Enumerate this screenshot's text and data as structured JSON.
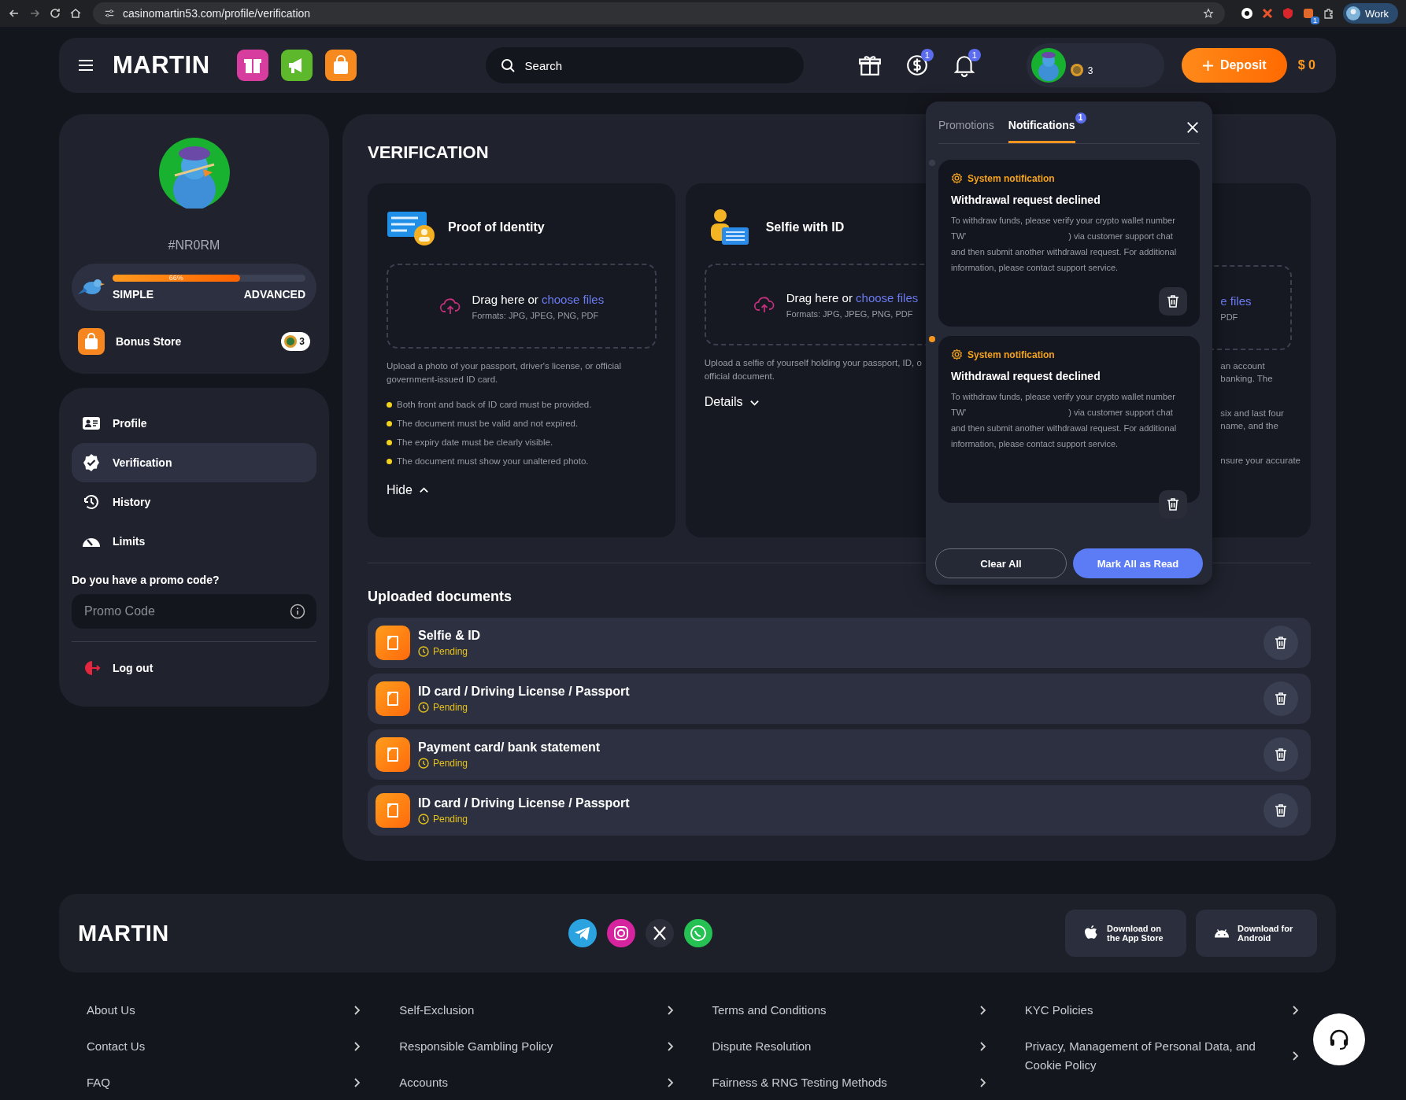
{
  "browser": {
    "url": "casinomartin53.com/profile/verification",
    "extension_badge": "1",
    "profile": "Work"
  },
  "header": {
    "logo": "MARTIN",
    "search": {
      "placeholder": "Search"
    },
    "coin_badge": "1",
    "bell_badge": "1",
    "coins": "3",
    "deposit": "Deposit",
    "balance": "$ 0"
  },
  "profile": {
    "username": "#NR0RM",
    "progress": {
      "level": 0.66,
      "label": "66%",
      "from": "SIMPLE",
      "to": "ADVANCED"
    },
    "bonus_store": {
      "label": "Bonus Store",
      "count": "3"
    }
  },
  "menu": [
    {
      "label": "Profile",
      "kind": "profile",
      "selected": false
    },
    {
      "label": "Verification",
      "kind": "verification",
      "selected": true
    },
    {
      "label": "History",
      "kind": "history",
      "selected": false
    },
    {
      "label": "Limits",
      "kind": "limits",
      "selected": false
    }
  ],
  "promo": {
    "question": "Do you have a promo code?",
    "placeholder": "Promo Code"
  },
  "logout": "Log out",
  "page_title": "VERIFICATION",
  "cards": [
    {
      "kind": "id",
      "title": "Proof of Identity",
      "drag": "Drag here or",
      "link": "choose files",
      "formats": "Formats: JPG, JPEG, PNG, PDF",
      "description": "Upload a photo of your passport, driver's license, or official government-issued ID card.",
      "requirements": [
        "Both front and back of ID card must be provided.",
        "The document must be valid and not expired.",
        "The expiry date must be clearly visible.",
        "The document must show your unaltered photo."
      ],
      "expanded": true,
      "toggle": "Hide"
    },
    {
      "kind": "selfie",
      "title": "Selfie with ID",
      "drag": "Drag here or",
      "link": "choose files",
      "formats": "Formats: JPG, JPEG, PNG, PDF",
      "description": "Upload a selfie of yourself holding your passport, ID, o official document.",
      "expanded": false,
      "toggle": "Details"
    }
  ],
  "partial_card": {
    "link": "e files",
    "formats": "PDF",
    "fragments": [
      [
        "an account",
        "banking. The"
      ],
      [
        "six and last four",
        "name, and the"
      ],
      [
        "nsure your accurate"
      ]
    ]
  },
  "uploaded": {
    "title": "Uploaded documents",
    "documents": [
      {
        "title": "Selfie & ID",
        "status": "Pending"
      },
      {
        "title": "ID card / Driving License / Passport",
        "status": "Pending"
      },
      {
        "title": "Payment card/ bank statement",
        "status": "Pending"
      },
      {
        "title": "ID card / Driving License / Passport",
        "status": "Pending"
      }
    ]
  },
  "notifications": {
    "tabs": [
      {
        "label": "Promotions",
        "selected": false
      },
      {
        "label": "Notifications",
        "selected": true,
        "badge": "1"
      }
    ],
    "items": [
      {
        "category": "System notification",
        "title": "Withdrawal request declined",
        "body_before": "To withdraw funds, please verify your crypto wallet number TW'",
        "body_after": ") via customer support chat and then submit another withdrawal request. For additional information, please contact support service.",
        "unread": false
      },
      {
        "category": "System notification",
        "title": "Withdrawal request declined",
        "body_before": "To withdraw funds, please verify your crypto wallet number TW'",
        "body_after": ") via customer support chat and then submit another withdrawal request. For additional information, please contact support service.",
        "unread": true
      }
    ],
    "clear": "Clear All",
    "mark_read": "Mark All as Read"
  },
  "footer": {
    "logo": "MARTIN",
    "socials": [
      {
        "kind": "telegram"
      },
      {
        "kind": "instagram"
      },
      {
        "kind": "x"
      },
      {
        "kind": "whatsapp"
      }
    ],
    "apps": [
      {
        "kind": "apple",
        "label": "Download on the App Store"
      },
      {
        "kind": "android",
        "label": "Download for Android"
      }
    ],
    "columns": [
      [
        "About Us",
        "Contact Us",
        "FAQ"
      ],
      [
        "Self-Exclusion",
        "Responsible Gambling Policy",
        "Accounts"
      ],
      [
        "Terms and Conditions",
        "Dispute Resolution",
        "Fairness & RNG Testing Methods"
      ],
      [
        "KYC Policies",
        "Privacy, Management of Personal Data, and Cookie Policy"
      ]
    ]
  }
}
